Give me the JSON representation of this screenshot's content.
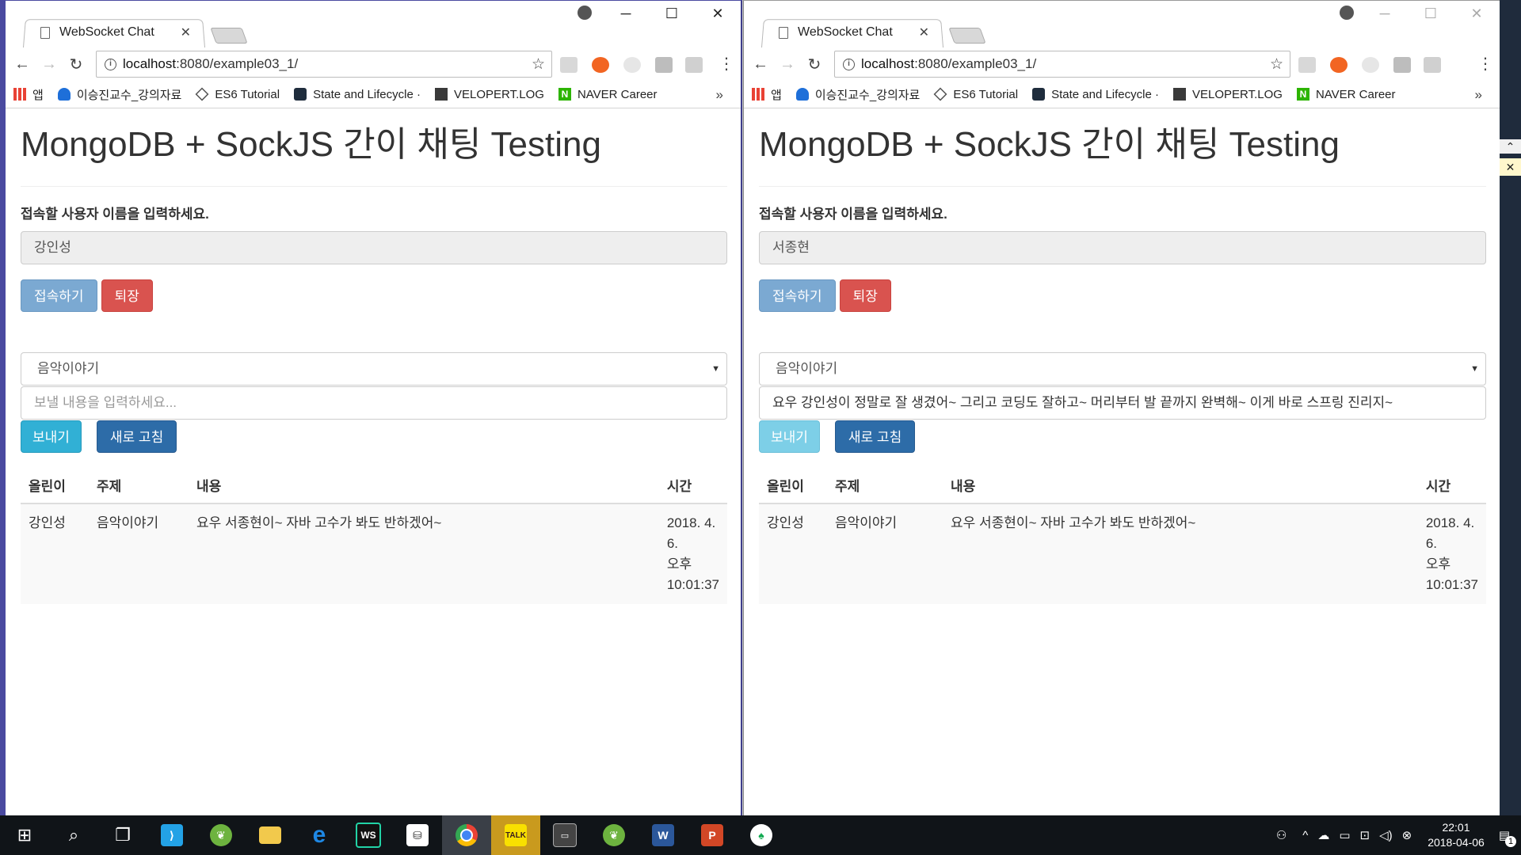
{
  "windows": {
    "left": {
      "tab_title": "WebSocket Chat",
      "url_host": "localhost",
      "url_rest": ":8080/example03_1/",
      "page_title": "MongoDB + SockJS 간이 채팅 Testing",
      "name_label": "접속할 사용자 이름을 입력하세요.",
      "name_value": "강인성",
      "connect_label": "접속하기",
      "leave_label": "퇴장",
      "topic_selected": "음악이야기",
      "message_value": "",
      "message_placeholder": "보낼 내용을 입력하세요...",
      "send_label": "보내기",
      "refresh_label": "새로 고침",
      "table": {
        "headers": [
          "올린이",
          "주제",
          "내용",
          "시간"
        ],
        "rows": [
          {
            "author": "강인성",
            "topic": "음악이야기",
            "content": "요우 서종현이~ 자바 고수가 봐도 반하겠어~",
            "time_lines": [
              "2018. 4.",
              "6.",
              "오후",
              "10:01:37"
            ]
          }
        ]
      }
    },
    "right": {
      "tab_title": "WebSocket Chat",
      "url_host": "localhost",
      "url_rest": ":8080/example03_1/",
      "page_title": "MongoDB + SockJS 간이 채팅 Testing",
      "name_label": "접속할 사용자 이름을 입력하세요.",
      "name_value": "서종현",
      "connect_label": "접속하기",
      "leave_label": "퇴장",
      "topic_selected": "음악이야기",
      "message_value": "요우 강인성이 정말로 잘 생겼어~ 그리고 코딩도 잘하고~ 머리부터 발 끝까지 완벽해~ 이게 바로 스프링 진리지~",
      "message_placeholder": "보낼 내용을 입력하세요...",
      "send_label": "보내기",
      "refresh_label": "새로 고침",
      "table": {
        "headers": [
          "올린이",
          "주제",
          "내용",
          "시간"
        ],
        "rows": [
          {
            "author": "강인성",
            "topic": "음악이야기",
            "content": "요우 서종현이~ 자바 고수가 봐도 반하겠어~",
            "time_lines": [
              "2018. 4.",
              "6.",
              "오후",
              "10:01:37"
            ]
          }
        ]
      }
    }
  },
  "bookmarks": [
    {
      "label": "앱",
      "icon": "apps-grid-icon",
      "color": "#e94235"
    },
    {
      "label": "이승진교수_강의자료",
      "icon": "cloud-icon",
      "color": "#1e6fd9"
    },
    {
      "label": "ES6 Tutorial",
      "icon": "diamond-icon",
      "color": "#555555"
    },
    {
      "label": "State and Lifecycle ·",
      "icon": "react-icon",
      "color": "#1f2d3d"
    },
    {
      "label": "VELOPERT.LOG",
      "icon": "velopert-icon",
      "color": "#3a3a3a"
    },
    {
      "label": "NAVER Career",
      "icon": "naver-icon",
      "color": "#2db400"
    }
  ],
  "bookmarks_more": "»",
  "taskbar": {
    "clock_time": "22:01",
    "clock_date": "2018-04-06",
    "notification_count": "1",
    "apps": [
      {
        "name": "start-button",
        "icon": "windows-icon"
      },
      {
        "name": "search-button",
        "icon": "search-icon"
      },
      {
        "name": "task-view-button",
        "icon": "task-view-icon"
      },
      {
        "name": "vscode",
        "icon": "vscode-icon",
        "color": "#23a2e6"
      },
      {
        "name": "spring-tool",
        "icon": "leaf-icon",
        "color": "#6db33f"
      },
      {
        "name": "file-explorer",
        "icon": "folder-icon",
        "color": "#f2c94c"
      },
      {
        "name": "edge",
        "icon": "edge-icon",
        "color": "#1e88e5"
      },
      {
        "name": "webstorm",
        "icon": "webstorm-icon",
        "color": "#22d3a6"
      },
      {
        "name": "store",
        "icon": "store-icon",
        "color": "#ffffff"
      },
      {
        "name": "chrome",
        "icon": "chrome-icon",
        "color": "#ea4335",
        "active": true
      },
      {
        "name": "kakaotalk",
        "icon": "talk-icon",
        "color": "#f9e000",
        "label": "TALK"
      },
      {
        "name": "terminal",
        "icon": "terminal-icon",
        "color": "#444444"
      },
      {
        "name": "spring-tool-2",
        "icon": "leaf-icon",
        "color": "#6db33f"
      },
      {
        "name": "word",
        "icon": "word-icon",
        "color": "#2b579a",
        "label": "W"
      },
      {
        "name": "powerpoint",
        "icon": "powerpoint-icon",
        "color": "#d24726",
        "label": "P"
      },
      {
        "name": "mongodb-compass",
        "icon": "mongodb-leaf-icon",
        "color": "#13aa52"
      }
    ]
  },
  "colors": {
    "danger": "#d9534f",
    "info": "#31b0d5",
    "primary_dim": "#7ba9d2",
    "blue": "#2d6ca8"
  }
}
